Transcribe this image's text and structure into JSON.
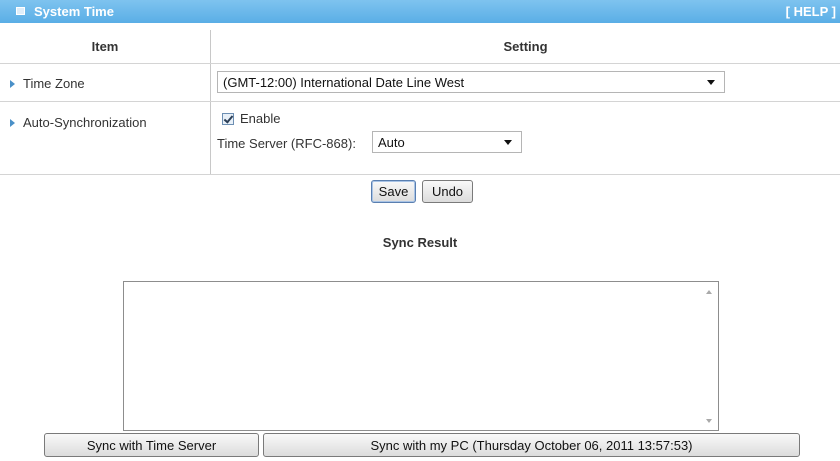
{
  "header": {
    "title": "System Time",
    "help_label": "[ HELP ]"
  },
  "table": {
    "col_item": "Item",
    "col_setting": "Setting"
  },
  "time_zone": {
    "label": "Time Zone",
    "value": "(GMT-12:00) International Date Line West"
  },
  "auto_sync": {
    "label": "Auto-Synchronization",
    "enable_label": "Enable",
    "enable_checked": true,
    "time_server_label": "Time Server (RFC-868):",
    "time_server_value": "Auto"
  },
  "buttons": {
    "save": "Save",
    "undo": "Undo"
  },
  "sync_result": {
    "title": "Sync Result",
    "text": ""
  },
  "sync_buttons": {
    "time_server": "Sync with Time Server",
    "pc": "Sync with my PC (Thursday October 06, 2011 13:57:53)"
  },
  "colors": {
    "header_bar": "#5aaee6",
    "accent_triangle": "#4a90c8"
  }
}
